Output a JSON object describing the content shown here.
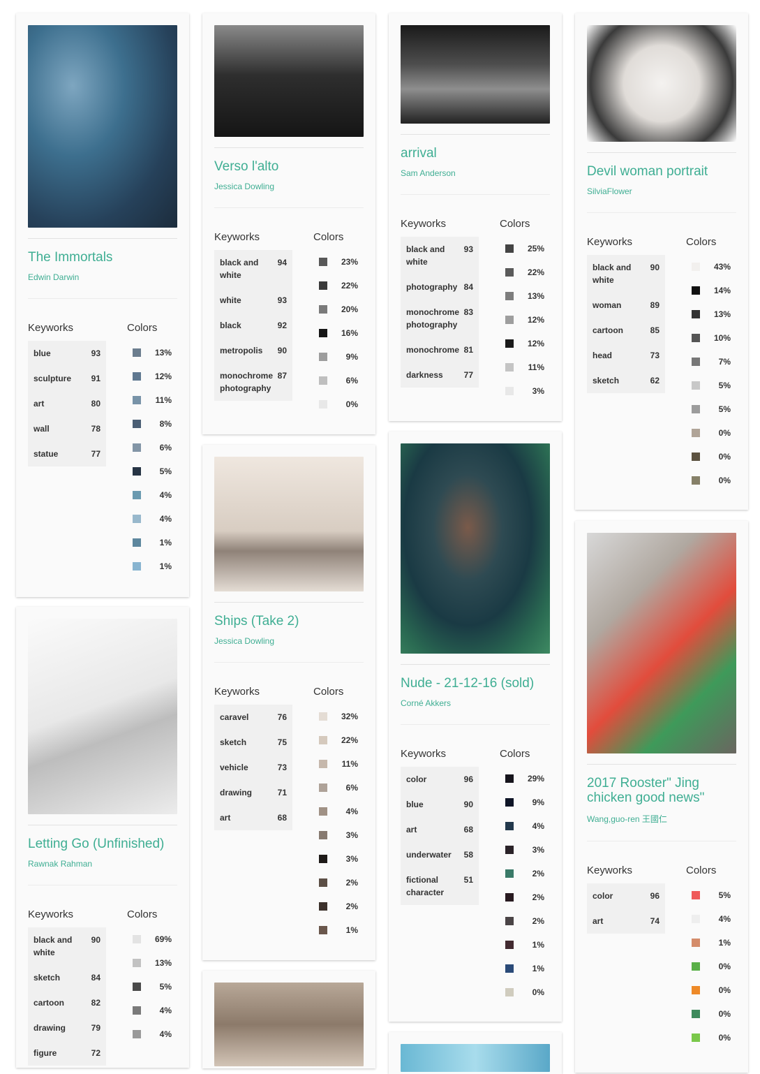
{
  "labels": {
    "keywords": "Keyworks",
    "colors": "Colors"
  },
  "cards": [
    {
      "title": "The Immortals",
      "author": "Edwin Darwin",
      "keywords": [
        [
          "blue",
          "93"
        ],
        [
          "sculpture",
          "91"
        ],
        [
          "art",
          "80"
        ],
        [
          "wall",
          "78"
        ],
        [
          "statue",
          "77"
        ]
      ],
      "colors": [
        [
          "#6b7d8e",
          "13%"
        ],
        [
          "#5f7890",
          "12%"
        ],
        [
          "#7893a8",
          "11%"
        ],
        [
          "#4a5e74",
          "8%"
        ],
        [
          "#8295a6",
          "6%"
        ],
        [
          "#263444",
          "5%"
        ],
        [
          "#6a9ab0",
          "4%"
        ],
        [
          "#98b8cc",
          "4%"
        ],
        [
          "#5d879e",
          "1%"
        ],
        [
          "#88b4d0",
          "1%"
        ]
      ]
    },
    {
      "title": "Letting Go (Unfinished)",
      "author": "Rawnak Rahman",
      "keywords": [
        [
          "black and white",
          "90"
        ],
        [
          "sketch",
          "84"
        ],
        [
          "cartoon",
          "82"
        ],
        [
          "drawing",
          "79"
        ],
        [
          "figure",
          "72"
        ]
      ],
      "colors": [
        [
          "#e3e3e3",
          "69%"
        ],
        [
          "#c2c2c2",
          "13%"
        ],
        [
          "#4a4a4a",
          "5%"
        ],
        [
          "#7a7a7a",
          "4%"
        ],
        [
          "#9a9a9a",
          "4%"
        ]
      ]
    },
    {
      "title": "Verso l'alto",
      "author": "Jessica Dowling",
      "keywords": [
        [
          "black and white",
          "94"
        ],
        [
          "white",
          "93"
        ],
        [
          "black",
          "92"
        ],
        [
          "metropolis",
          "90"
        ],
        [
          "monochrome photography",
          "87"
        ]
      ],
      "colors": [
        [
          "#585858",
          "23%"
        ],
        [
          "#3a3a3a",
          "22%"
        ],
        [
          "#7a7a7a",
          "20%"
        ],
        [
          "#161616",
          "16%"
        ],
        [
          "#9d9d9d",
          "9%"
        ],
        [
          "#bfbfbf",
          "6%"
        ],
        [
          "#e8e8e8",
          "0%"
        ]
      ]
    },
    {
      "title": "Ships (Take 2)",
      "author": "Jessica Dowling",
      "keywords": [
        [
          "caravel",
          "76"
        ],
        [
          "sketch",
          "75"
        ],
        [
          "vehicle",
          "73"
        ],
        [
          "drawing",
          "71"
        ],
        [
          "art",
          "68"
        ]
      ],
      "colors": [
        [
          "#e4dcd4",
          "32%"
        ],
        [
          "#d5c9bd",
          "22%"
        ],
        [
          "#c6b8ac",
          "11%"
        ],
        [
          "#aea298",
          "6%"
        ],
        [
          "#a09185",
          "4%"
        ],
        [
          "#877a70",
          "3%"
        ],
        [
          "#1e1a18",
          "3%"
        ],
        [
          "#5c4f46",
          "2%"
        ],
        [
          "#3c312b",
          "2%"
        ],
        [
          "#6a574c",
          "1%"
        ]
      ]
    },
    {
      "title": "arrival",
      "author": "Sam Anderson",
      "keywords": [
        [
          "black and white",
          "93"
        ],
        [
          "photography",
          "84"
        ],
        [
          "monochrome photography",
          "83"
        ],
        [
          "monochrome",
          "81"
        ],
        [
          "darkness",
          "77"
        ]
      ],
      "colors": [
        [
          "#444444",
          "25%"
        ],
        [
          "#5a5a5a",
          "22%"
        ],
        [
          "#7d7d7d",
          "13%"
        ],
        [
          "#9e9e9e",
          "12%"
        ],
        [
          "#1a1a1a",
          "12%"
        ],
        [
          "#c4c4c4",
          "11%"
        ],
        [
          "#e8e8e8",
          "3%"
        ]
      ]
    },
    {
      "title": "Nude - 21-12-16 (sold)",
      "author": "Corné Akkers",
      "keywords": [
        [
          "color",
          "96"
        ],
        [
          "blue",
          "90"
        ],
        [
          "art",
          "68"
        ],
        [
          "underwater",
          "58"
        ],
        [
          "fictional character",
          "51"
        ]
      ],
      "colors": [
        [
          "#16141c",
          "29%"
        ],
        [
          "#0e1426",
          "9%"
        ],
        [
          "#22384c",
          "4%"
        ],
        [
          "#2a2228",
          "3%"
        ],
        [
          "#3a7a68",
          "2%"
        ],
        [
          "#281a20",
          "2%"
        ],
        [
          "#4a4446",
          "2%"
        ],
        [
          "#422a30",
          "1%"
        ],
        [
          "#2a4a78",
          "1%"
        ],
        [
          "#d0ccbe",
          "0%"
        ]
      ]
    },
    {
      "title": "Devil woman portrait",
      "author": "SilviaFlower",
      "keywords": [
        [
          "black and white",
          "90"
        ],
        [
          "woman",
          "89"
        ],
        [
          "cartoon",
          "85"
        ],
        [
          "head",
          "73"
        ],
        [
          "sketch",
          "62"
        ]
      ],
      "colors": [
        [
          "#f2f0ee",
          "43%"
        ],
        [
          "#111111",
          "14%"
        ],
        [
          "#333333",
          "13%"
        ],
        [
          "#555555",
          "10%"
        ],
        [
          "#777777",
          "7%"
        ],
        [
          "#c8c8c8",
          "5%"
        ],
        [
          "#9c9c9c",
          "5%"
        ],
        [
          "#b0a498",
          "0%"
        ],
        [
          "#5c5240",
          "0%"
        ],
        [
          "#868068",
          "0%"
        ]
      ]
    },
    {
      "title": "2017 Rooster\" Jing chicken good news\"",
      "author": "Wang,guo-ren 王國仁",
      "keywords": [
        [
          "color",
          "96"
        ],
        [
          "art",
          "74"
        ]
      ],
      "colors": [
        [
          "#ef5a5a",
          "5%"
        ],
        [
          "#eeeeee",
          "4%"
        ],
        [
          "#d48c6a",
          "1%"
        ],
        [
          "#5ab048",
          "0%"
        ],
        [
          "#ee8a28",
          "0%"
        ],
        [
          "#3e8a5c",
          "0%"
        ],
        [
          "#7ac84a",
          "0%"
        ]
      ]
    }
  ]
}
